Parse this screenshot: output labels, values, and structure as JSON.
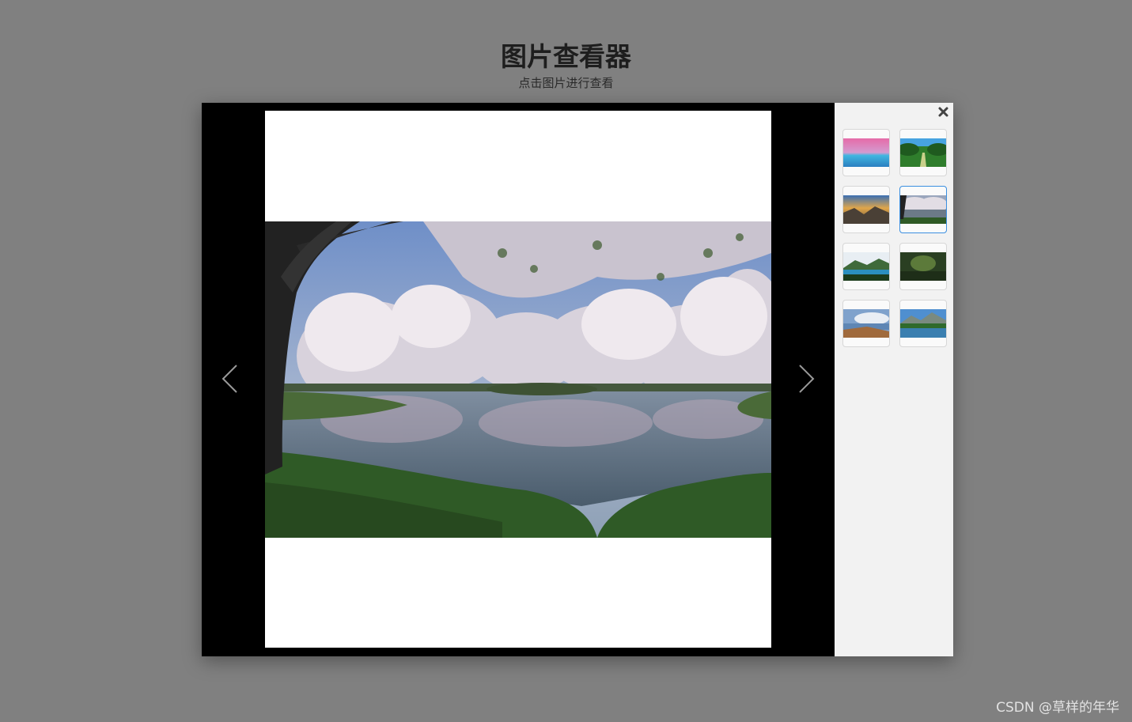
{
  "header": {
    "title": "图片查看器",
    "subtitle": "点击图片进行查看"
  },
  "viewer": {
    "prev_icon": "chevron-left-icon",
    "next_icon": "chevron-right-icon",
    "close_icon": "close-icon",
    "active_index": 3,
    "thumbnails": [
      {
        "name": "pink-sea-sunset"
      },
      {
        "name": "green-forest-road"
      },
      {
        "name": "mountain-sunset-rocks"
      },
      {
        "name": "cherry-blossom-lake"
      },
      {
        "name": "green-mountain-lake"
      },
      {
        "name": "dark-forest"
      },
      {
        "name": "coast-clouds"
      },
      {
        "name": "mountain-reflection"
      }
    ]
  },
  "watermark": "CSDN @草样的年华",
  "colors": {
    "background": "#808080",
    "stage": "#000000",
    "panel": "#f2f2f2",
    "active_border": "#3b8fe0"
  }
}
